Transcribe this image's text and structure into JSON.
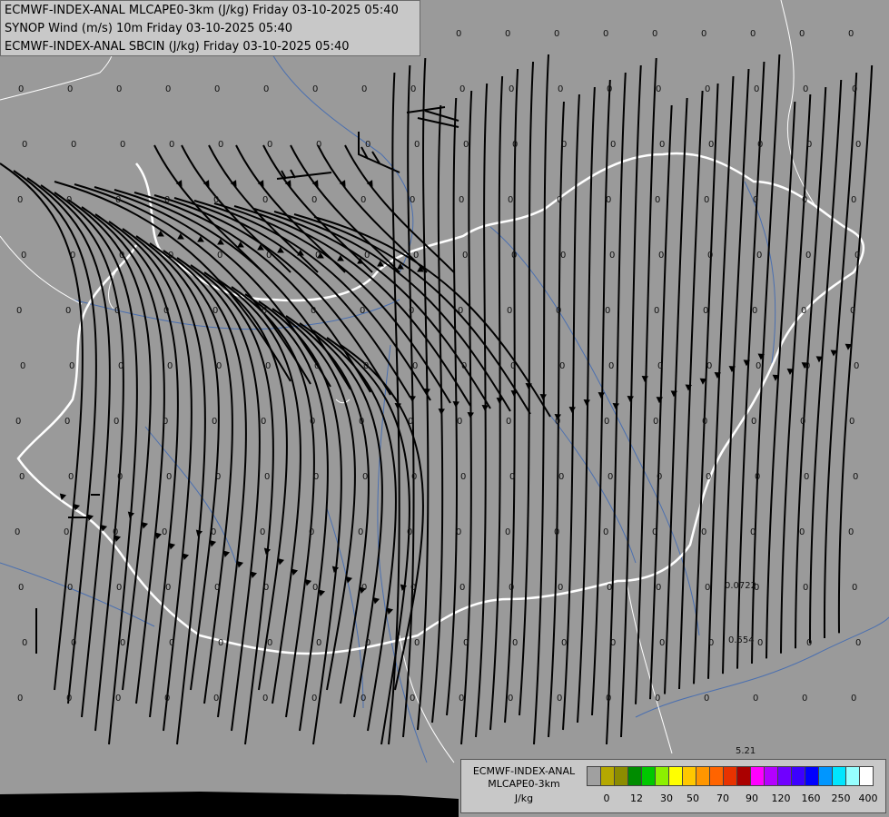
{
  "titles": [
    "ECMWF-INDEX-ANAL MLCAPE0-3km (J/kg) Friday 03-10-2025 05:40",
    "SYNOP Wind (m/s) 10m Friday 03-10-2025 05:40",
    "ECMWF-INDEX-ANAL SBCIN (J/kg) Friday 03-10-2025 05:40"
  ],
  "legend": {
    "line1": "ECMWF-INDEX-ANAL",
    "line2": "MLCAPE0-3km",
    "unit": "J/kg",
    "colors": [
      "#a0a0a0",
      "#b5a800",
      "#8c8c00",
      "#008c00",
      "#00c800",
      "#8cf000",
      "#ffff00",
      "#ffc800",
      "#ff9600",
      "#ff6400",
      "#e83200",
      "#aa0000",
      "#ff00ff",
      "#b400ff",
      "#7000ff",
      "#3c00ff",
      "#0000ff",
      "#0096ff",
      "#00e6ff",
      "#96ffff",
      "#ffffff"
    ],
    "ticks": [
      "0",
      "12",
      "30",
      "50",
      "70",
      "90",
      "120",
      "160",
      "250",
      "400"
    ]
  },
  "values": {
    "zeros_label": "0",
    "special": [
      "0.0722",
      "0.554",
      "5.21"
    ]
  }
}
